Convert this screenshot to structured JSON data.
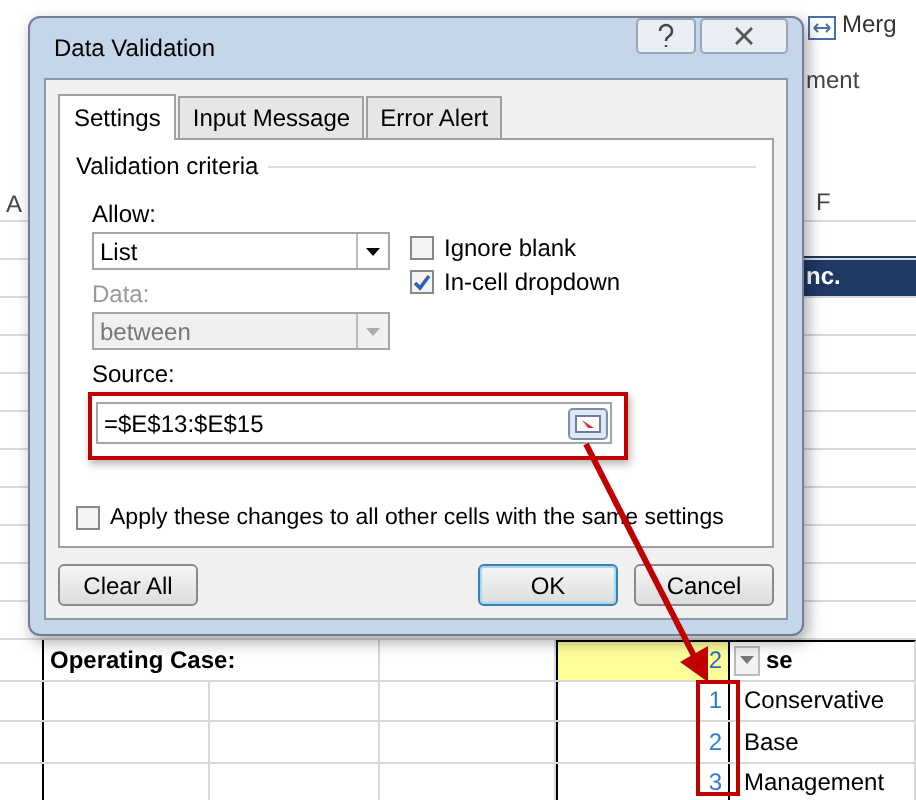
{
  "ribbon": {
    "merge_label": "Merg",
    "group_label": "ment"
  },
  "sheet": {
    "column_headers": [
      "A",
      "F"
    ],
    "header_cell": "nc.",
    "operating_case": {
      "label": "Operating Case:",
      "value": "2",
      "display": "se"
    },
    "list_items": [
      {
        "index": "1",
        "label": "Conservative"
      },
      {
        "index": "2",
        "label": "Base"
      },
      {
        "index": "3",
        "label": "Management"
      }
    ]
  },
  "dialog": {
    "title": "Data Validation",
    "tabs": [
      {
        "label": "Settings",
        "selected": true
      },
      {
        "label": "Input Message",
        "selected": false
      },
      {
        "label": "Error Alert",
        "selected": false
      }
    ],
    "group_title": "Validation criteria",
    "allow": {
      "label": "Allow:",
      "value": "List"
    },
    "options": [
      {
        "label": "Ignore blank",
        "checked": false
      },
      {
        "label": "In-cell dropdown",
        "checked": true
      }
    ],
    "data": {
      "label": "Data:",
      "value": "between",
      "disabled": true
    },
    "source": {
      "label": "Source:",
      "value": "=$E$13:$E$15"
    },
    "apply": {
      "label": "Apply these changes to all other cells with the same settings",
      "checked": false
    },
    "buttons": [
      {
        "label": "Clear All",
        "kind": "plain"
      },
      {
        "label": "OK",
        "kind": "default"
      },
      {
        "label": "Cancel",
        "kind": "plain"
      }
    ]
  }
}
